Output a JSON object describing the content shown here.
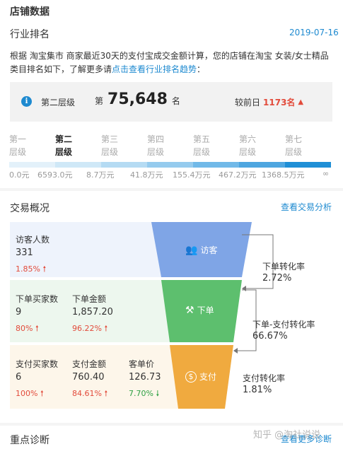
{
  "shop_data_title": "店铺数据",
  "industry_rank": {
    "title": "行业排名",
    "date": "2019-07-16",
    "desc_line1": "根据 淘宝集市 商家最近30天的支付宝成交金额计算，您的店铺在淘宝 女装/女士精品",
    "desc_line2_prefix": "类目排名如下，了解更多请",
    "desc_link": "点击查看行业排名趋势",
    "desc_line2_suffix": "：",
    "current_level": "第二层级",
    "rank_prefix": "第",
    "rank_value": "75,648",
    "rank_suffix": "名",
    "compare_label": "较前日",
    "compare_value": "1173名",
    "levels": [
      {
        "line1": "第一",
        "line2": "层级"
      },
      {
        "line1": "第二",
        "line2": "层级"
      },
      {
        "line1": "第三",
        "line2": "层级"
      },
      {
        "line1": "第四",
        "line2": "层级"
      },
      {
        "line1": "第五",
        "line2": "层级"
      },
      {
        "line1": "第六",
        "line2": "层级"
      },
      {
        "line1": "第七",
        "line2": "层级"
      }
    ],
    "thresholds": [
      "0.0元",
      "6593.0元",
      "8.7万元",
      "41.8万元",
      "155.4万元",
      "467.2万元",
      "1368.5万元",
      "∞"
    ],
    "bar_colors": [
      "#e3f1fa",
      "#cfe8f7",
      "#b5dbf3",
      "#95cbee",
      "#71b9e8",
      "#4ea6e0",
      "#1f8fd6"
    ]
  },
  "trade": {
    "title": "交易概况",
    "link": "查看交易分析",
    "visitors_label": "访客人数",
    "visitors_value": "331",
    "visitors_pct": "1.85%",
    "buyers_label": "下单买家数",
    "buyers_value": "9",
    "buyers_pct": "80%",
    "order_amount_label": "下单金额",
    "order_amount_value": "1,857.20",
    "order_amount_pct": "96.22%",
    "pay_buyers_label": "支付买家数",
    "pay_buyers_value": "6",
    "pay_buyers_pct": "100%",
    "pay_amount_label": "支付金额",
    "pay_amount_value": "760.40",
    "pay_amount_pct": "84.61%",
    "unit_price_label": "客单价",
    "unit_price_value": "126.73",
    "unit_price_pct": "7.70%",
    "funnel_visit": "访客",
    "funnel_order": "下单",
    "funnel_pay": "支付",
    "conv1_label": "下单转化率",
    "conv1_value": "2.72%",
    "conv2_label": "下单-支付转化率",
    "conv2_value": "66.67%",
    "conv3_label": "支付转化率",
    "conv3_value": "1.81%",
    "colors": {
      "visit": "#7fa5e6",
      "order": "#5dbf6e",
      "pay": "#f0aa3f"
    }
  },
  "diagnosis": {
    "title": "重点诊断",
    "link": "查看更多诊断",
    "watermark": "知乎 @淘社说说"
  }
}
